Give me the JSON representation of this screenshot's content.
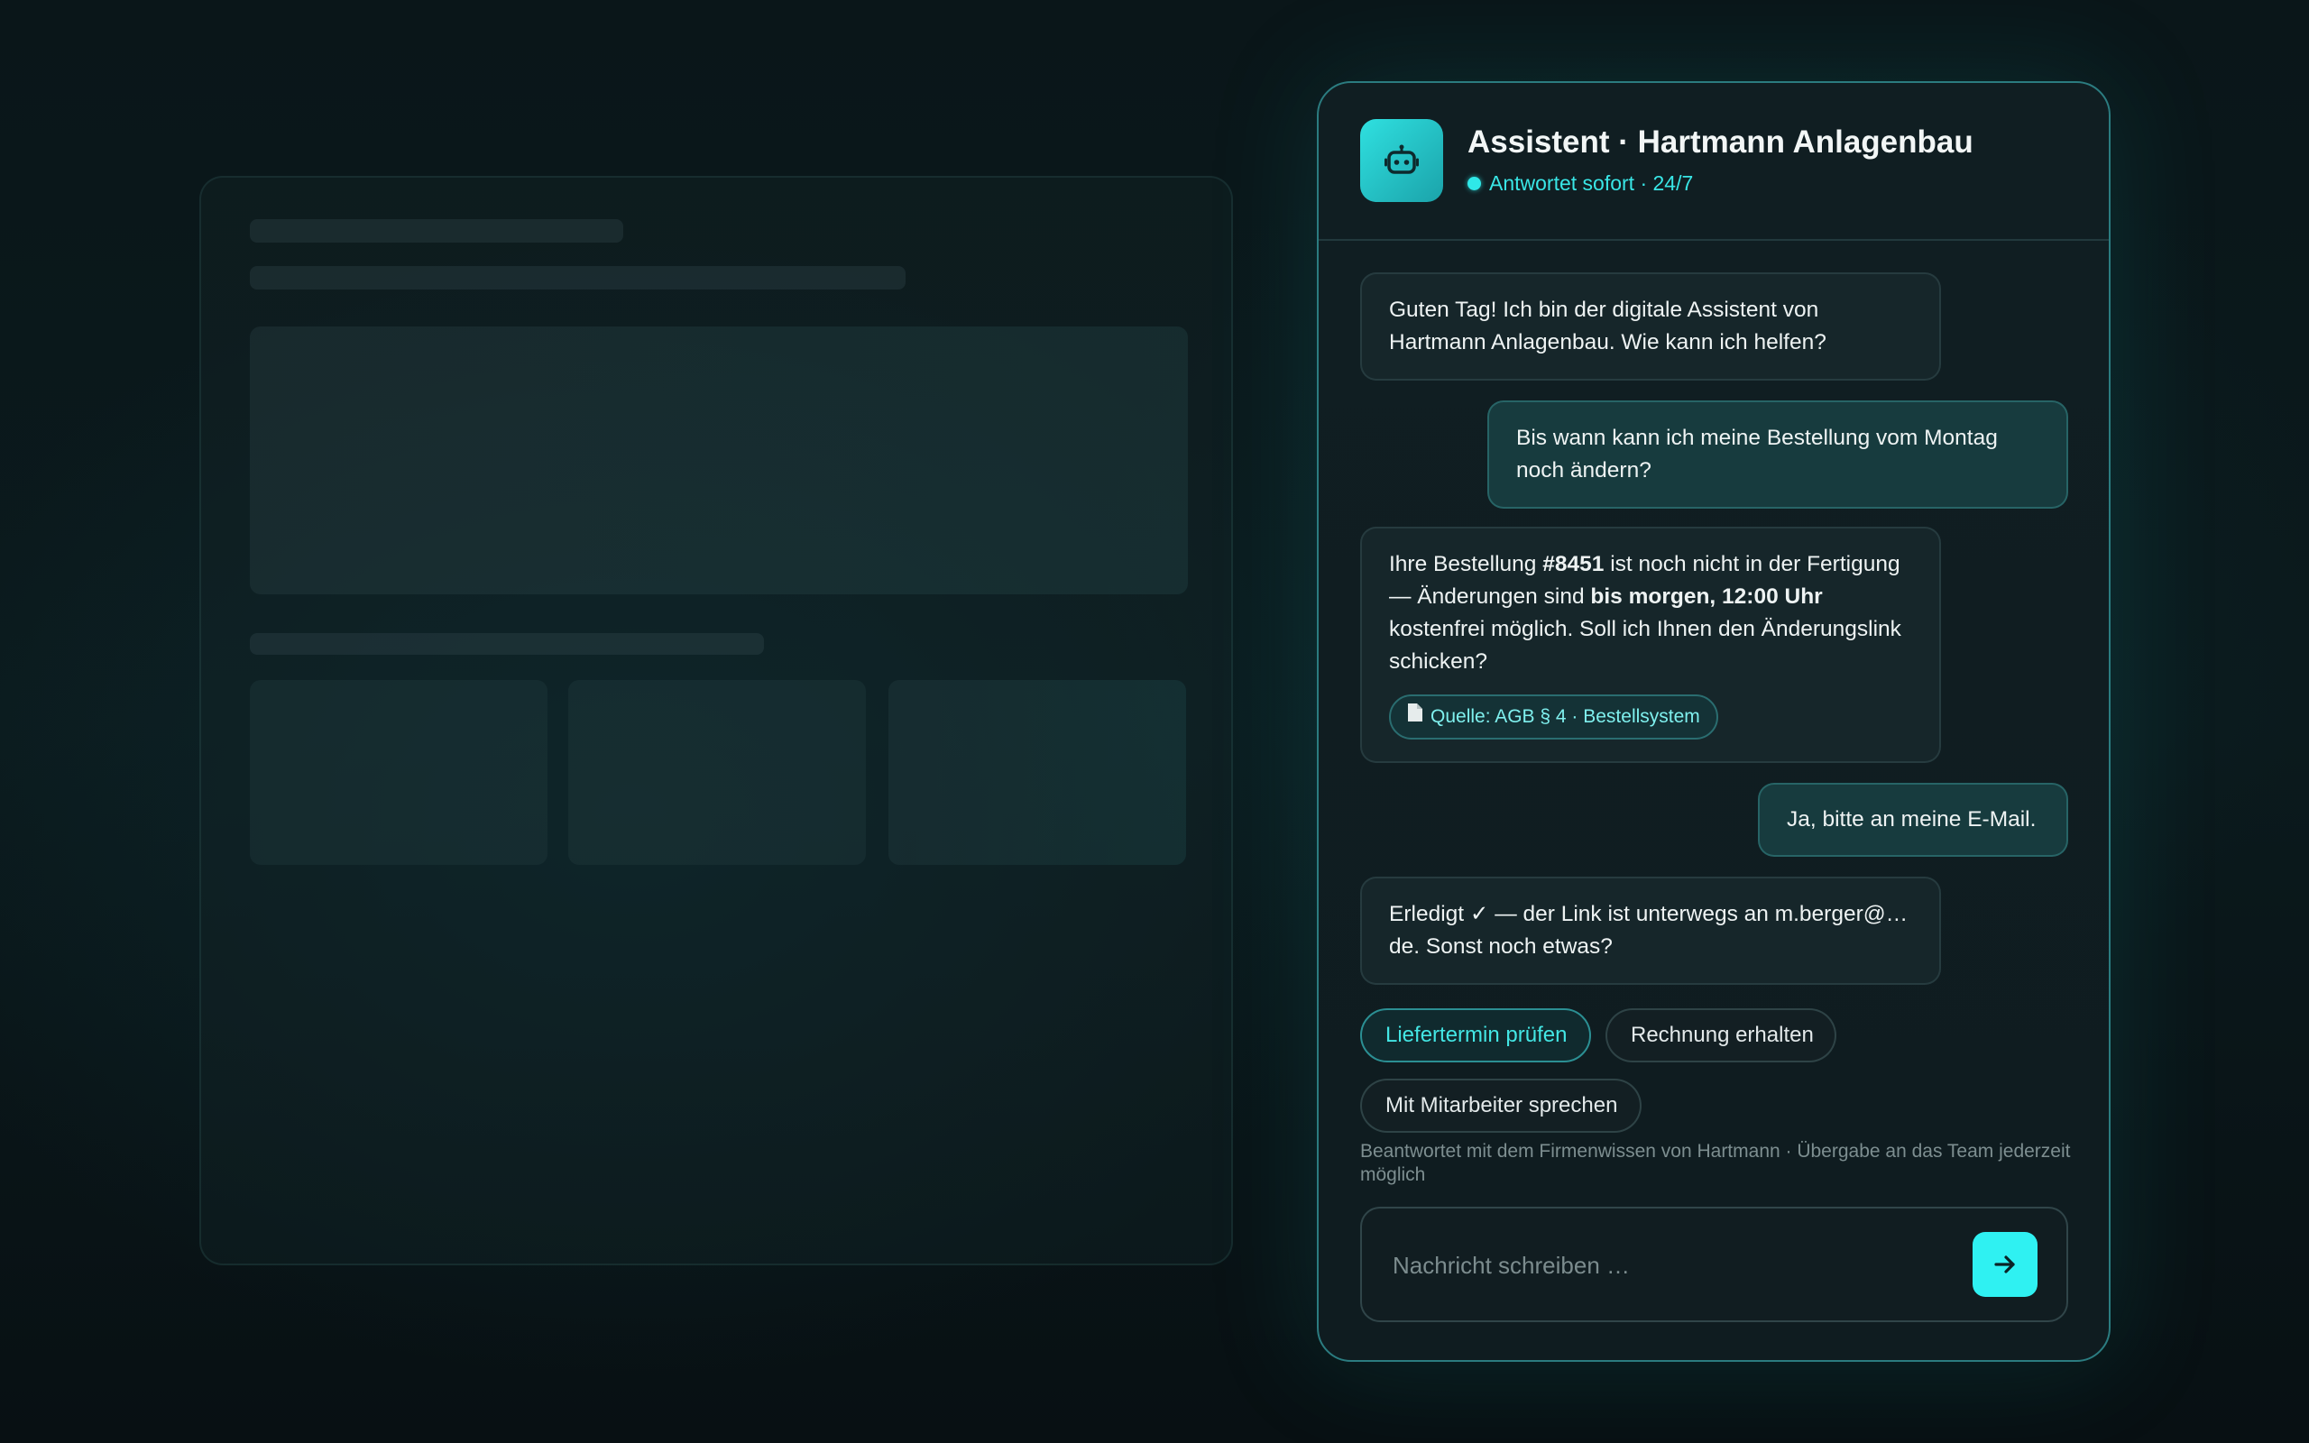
{
  "header": {
    "title": "Assistent · Hartmann Anlagenbau",
    "status": "Antwortet sofort · 24/7",
    "avatar_icon": "robot-icon"
  },
  "messages": [
    {
      "role": "bot",
      "text": "Guten Tag! Ich bin der digitale Assistent von Hartmann Anlagenbau. Wie kann ich helfen?"
    },
    {
      "role": "user",
      "text": "Bis wann kann ich meine Bestellung vom Montag noch ändern?"
    },
    {
      "role": "bot",
      "parts": {
        "p1": "Ihre Bestellung ",
        "order": "#8451",
        "p2": " ist noch nicht in der Fertigung — Änderungen sind ",
        "deadline": "bis morgen, 12:00 Uhr",
        "p3": " kostenfrei möglich. Soll ich Ihnen den Änderungslink schicken?"
      },
      "source": {
        "icon": "document-icon",
        "label": "Quelle: AGB § 4 · Bestellsystem"
      }
    },
    {
      "role": "user",
      "text": "Ja, bitte an meine E-Mail."
    },
    {
      "role": "bot",
      "text": "Erledigt ✓ — der Link ist unterwegs an m.berger@…de. Sonst noch etwas?"
    }
  ],
  "quick_replies": [
    {
      "label": "Liefertermin prüfen",
      "active": true
    },
    {
      "label": "Rechnung erhalten",
      "active": false
    },
    {
      "label": "Mit Mitarbeiter sprechen",
      "active": false
    }
  ],
  "footnote": "Beantwortet mit dem Firmenwissen von Hartmann · Übergabe an das Team jederzeit möglich",
  "composer": {
    "placeholder": "Nachricht schreiben …",
    "value": "",
    "send_icon": "arrow-right-icon"
  },
  "colors": {
    "accent": "#2ff1f2",
    "accent_text": "#39e6e6",
    "panel_border": "#2b7c80",
    "bot_bubble": "#16262a",
    "user_bubble": "#173b3e"
  }
}
